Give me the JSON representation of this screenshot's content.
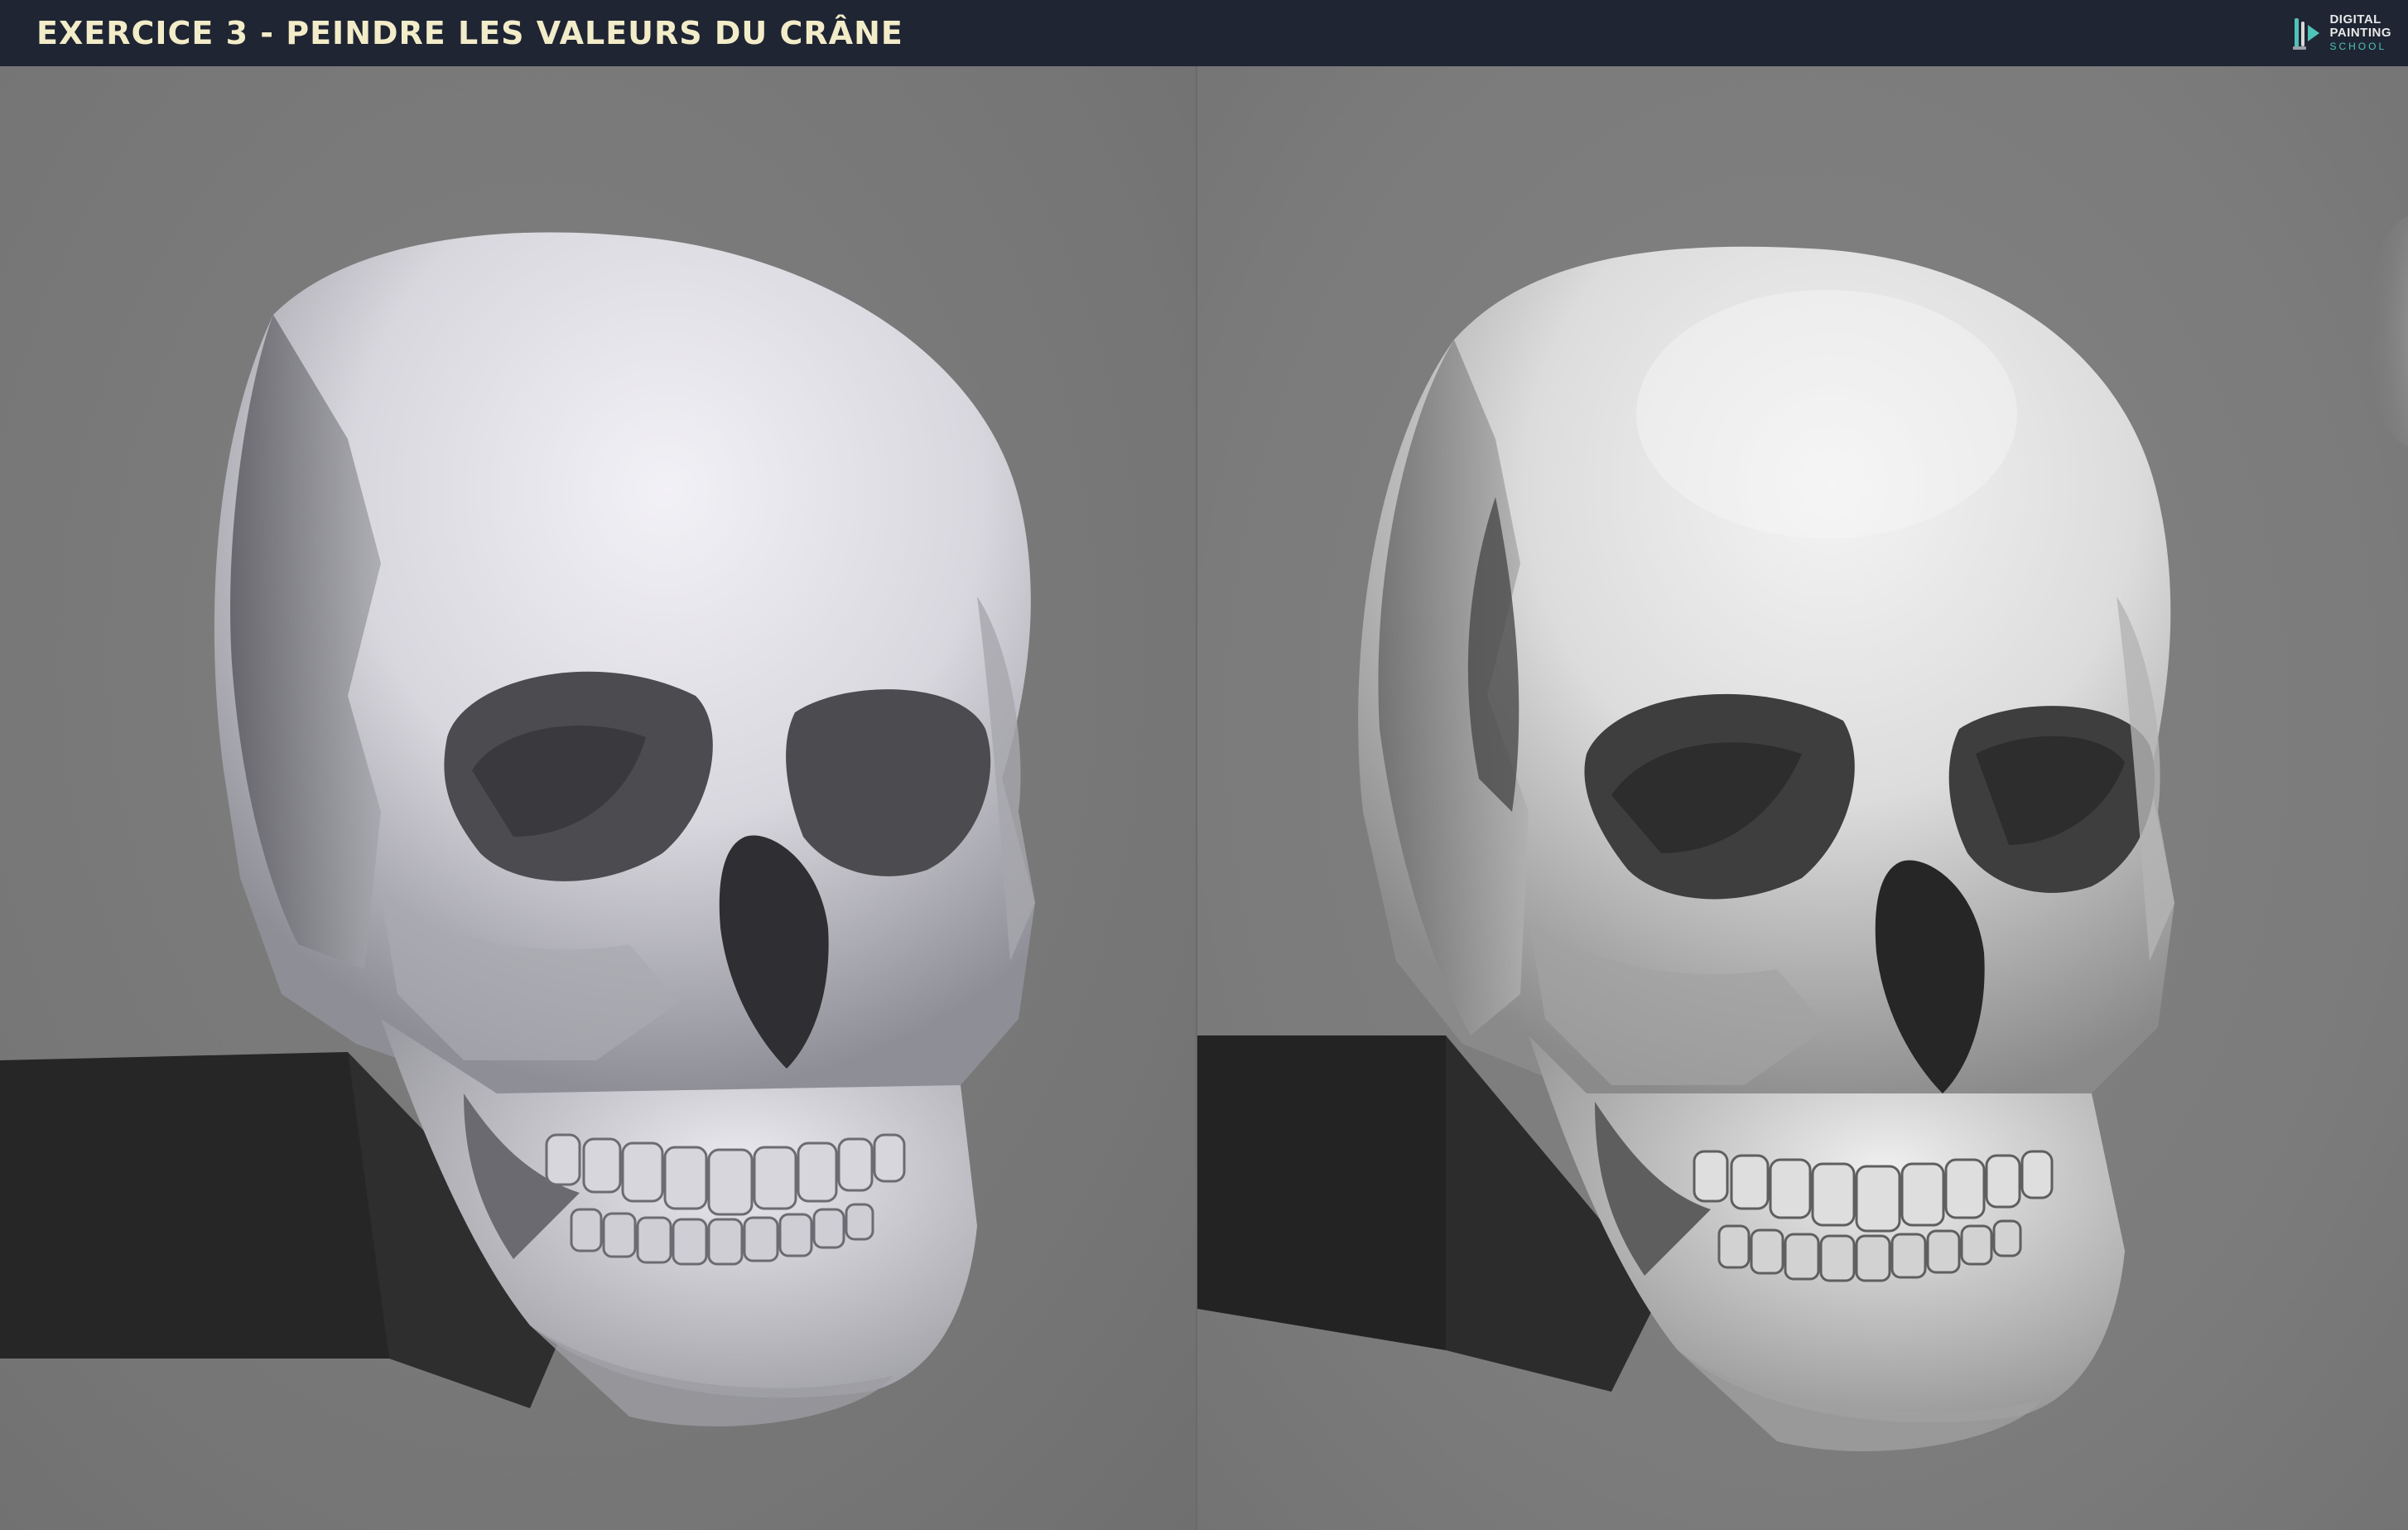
{
  "header": {
    "title": "EXERCICE 3 - PEINDRE LES VALEURS DU CRÂNE",
    "logo": {
      "line1": "DIGITAL",
      "line2": "PAINTING",
      "line3": "SCHOOL",
      "icon": "paintbrush-play-icon"
    }
  },
  "panels": [
    {
      "name": "reference-render"
    },
    {
      "name": "painted-study"
    }
  ],
  "colors": {
    "header_bg": "#1f2533",
    "title": "#f3ecc8",
    "background": "#7a7a7a",
    "shadow": "#222222",
    "bone_light": "#e9e9ee",
    "bone_mid": "#b9b9bf",
    "bone_dark": "#4a4a4e",
    "accent": "#4fc3b8"
  }
}
